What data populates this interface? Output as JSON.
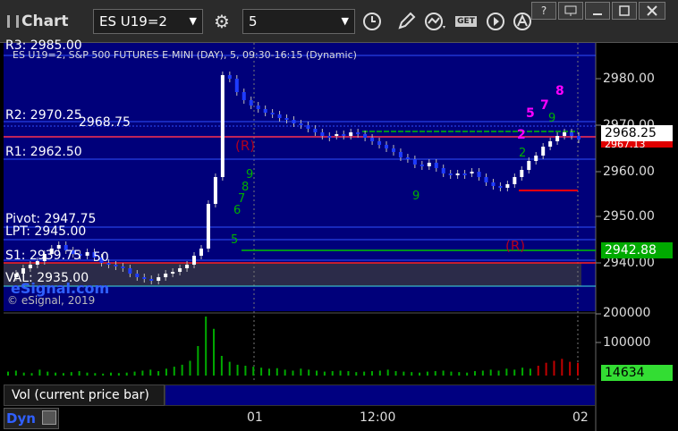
{
  "app": {
    "title": "Chart"
  },
  "toolbar": {
    "symbol": "ES U19=2",
    "interval": "5",
    "get_label": "GET"
  },
  "header": {
    "description": "ES U19=2, S&P 500 FUTURES E-MINI (DAY), 5, 09:30-16:15 (Dynamic)",
    "copyright": "© eSignal, 2019",
    "watermark": "eSignal.com"
  },
  "levels": {
    "r3": "R3: 2985.00",
    "r2": "R2: 2970.25",
    "r2b": "2968.75",
    "r1": "R1: 2962.50",
    "pivot": "Pivot: 2947.75",
    "lpt": "LPT: 2945.00",
    "s1": "S1: 2939.75",
    "s1b": "50",
    "val": "VAL: 2935.00"
  },
  "price_axis": {
    "ticks": [
      "2980.00",
      "2970.00",
      "2960.00",
      "2950.00",
      "2940.00"
    ],
    "last_price": "2968.25",
    "last_price_secondary": "2967.13",
    "level_marker": "2942.88"
  },
  "volume": {
    "ticks": [
      "200000",
      "100000"
    ],
    "last_volume": "14634",
    "legend": "Vol (current price bar)"
  },
  "time_axis": {
    "ticks": [
      "01",
      "12:00",
      "02"
    ],
    "mode": "Dyn"
  },
  "annotations": {
    "r_top": "(R)",
    "r_bottom": "(R)",
    "magenta_8": "8",
    "magenta_7": "7",
    "magenta_5": "5",
    "magenta_2": "2"
  },
  "colors": {
    "background": "#000000",
    "price_panel": "#000080",
    "up_candle": "#ffffff",
    "down_candle": "#1e3cff",
    "level_red": "#ff0000",
    "level_green": "#00c000",
    "magenta": "#ff00ff",
    "accent": "#00aa00"
  }
}
